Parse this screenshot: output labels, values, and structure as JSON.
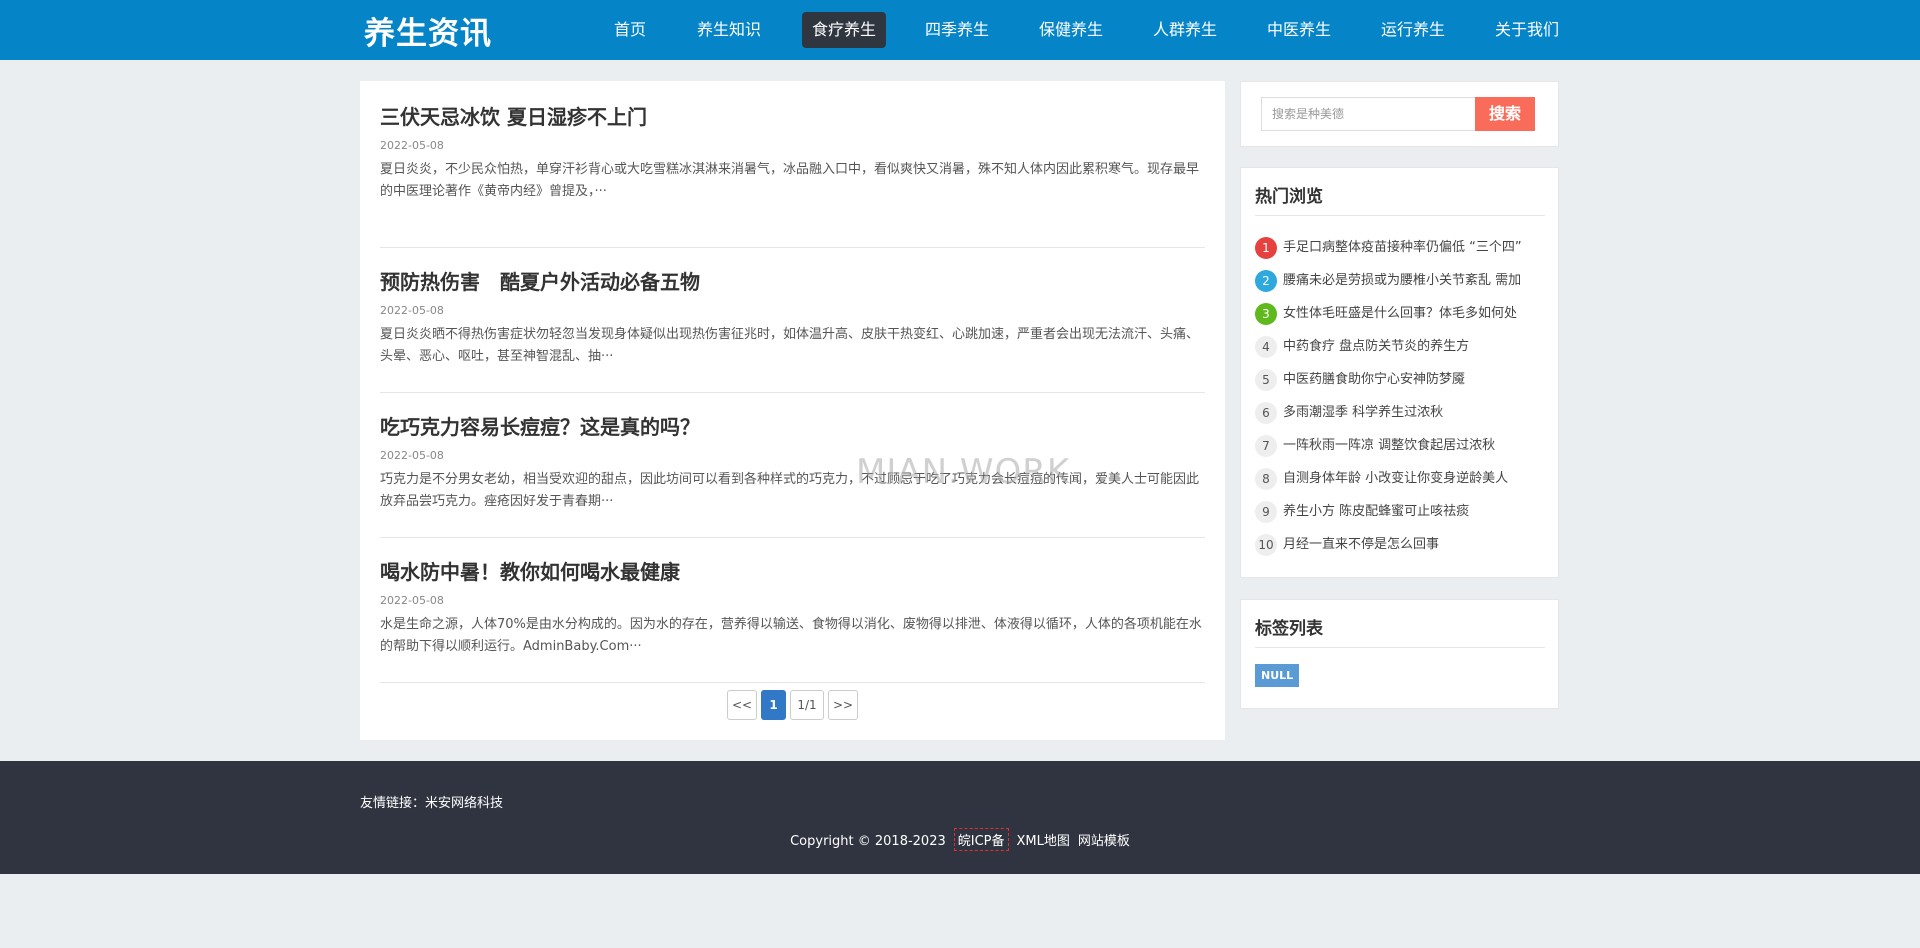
{
  "header": {
    "logo": "养生资讯",
    "nav": [
      "首页",
      "养生知识",
      "食疗养生",
      "四季养生",
      "保健养生",
      "人群养生",
      "中医养生",
      "运行养生",
      "关于我们"
    ],
    "active": "食疗养生"
  },
  "articles": [
    {
      "title": "三伏天忌冰饮 夏日湿疹不上门",
      "date": "2022-05-08",
      "excerpt": "夏日炎炎，不少民众怕热，单穿汗衫背心或大吃雪糕冰淇淋来消暑气，冰品融入口中，看似爽快又消暑，殊不知人体内因此累积寒气。现存最早的中医理论著作《黄帝内经》曾提及，···"
    },
    {
      "title": "预防热伤害　酷夏户外活动必备五物",
      "date": "2022-05-08",
      "excerpt": "夏日炎炎晒不得热伤害症状勿轻忽当发现身体疑似出现热伤害征兆时，如体温升高、皮肤干热变红、心跳加速，严重者会出现无法流汗、头痛、头晕、恶心、呕吐，甚至神智混乱、抽···"
    },
    {
      "title": "吃巧克力容易长痘痘？这是真的吗？",
      "date": "2022-05-08",
      "excerpt": "巧克力是不分男女老幼，相当受欢迎的甜点，因此坊间可以看到各种样式的巧克力，不过顾忌于吃了巧克力会长痘痘的传闻，爱美人士可能因此放弃品尝巧克力。痤疮因好发于青春期···"
    },
    {
      "title": "喝水防中暑！教你如何喝水最健康",
      "date": "2022-05-08",
      "excerpt": "水是生命之源，人体70%是由水分构成的。因为水的存在，营养得以输送、食物得以消化、废物得以排泄、体液得以循环，人体的各项机能在水的帮助下得以顺利运行。AdminBaby.Com···"
    }
  ],
  "pagination": {
    "prev": "<<",
    "current": "1",
    "info": "1/1",
    "next": ">>"
  },
  "search": {
    "placeholder": "搜索是种美德",
    "button": "搜索"
  },
  "hot": {
    "title": "热门浏览",
    "items": [
      "手足口病整体疫苗接种率仍偏低 “三个四”",
      "腰痛未必是劳损或为腰椎小关节紊乱 需加",
      "女性体毛旺盛是什么回事？体毛多如何处",
      "中药食疗 盘点防关节炎的养生方",
      "中医药膳食助你宁心安神防梦魇",
      "多雨潮湿季 科学养生过浓秋",
      "一阵秋雨一阵凉 调整饮食起居过浓秋",
      "自测身体年龄 小改变让你变身逆龄美人",
      "养生小方 陈皮配蜂蜜可止咳祛痰",
      "月经一直来不停是怎么回事"
    ]
  },
  "tags": {
    "title": "标签列表",
    "items": [
      "NULL"
    ]
  },
  "footer": {
    "friend_links": "友情链接：米安网络科技",
    "copyright": "Copyright © 2018-2023",
    "icp": "皖ICP备",
    "sitemap": "XML地图",
    "template": "网站模板"
  },
  "watermark": "MIAN.WORK"
}
